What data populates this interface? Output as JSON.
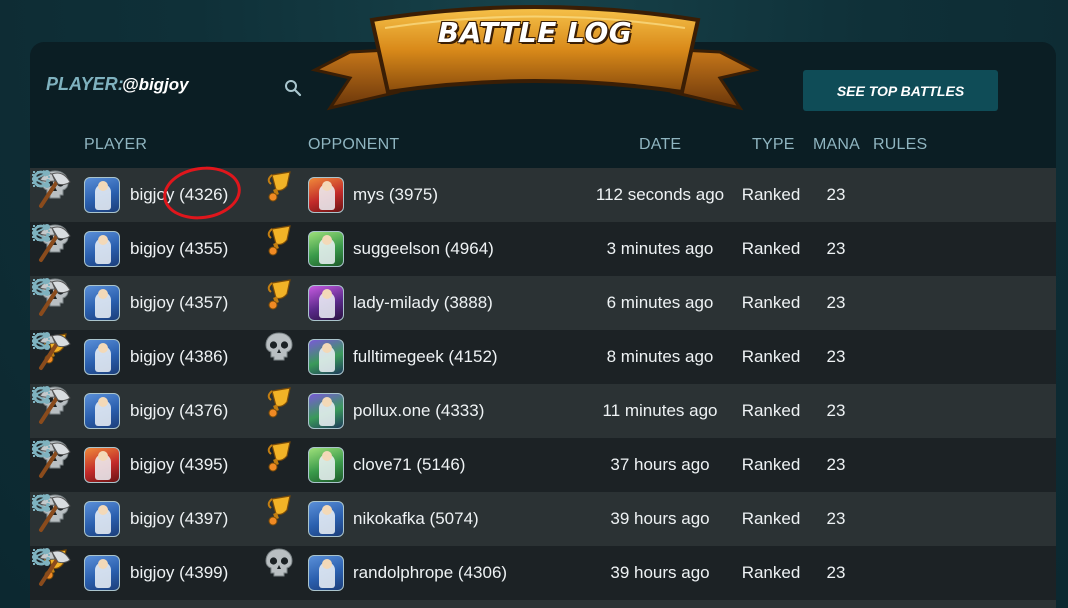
{
  "banner": {
    "title": "BATTLE LOG"
  },
  "player": {
    "label": "PLAYER:",
    "name": "@bigjoy"
  },
  "actions": {
    "top_battles": "SEE TOP BATTLES"
  },
  "columns": {
    "player": "PLAYER",
    "opponent": "OPPONENT",
    "date": "DATE",
    "type": "TYPE",
    "mana": "MANA",
    "rules": "RULES"
  },
  "rows": [
    {
      "result": "loss",
      "player": "bigjoy (4326)",
      "player_avatar": "wizard",
      "opponent": "mys (3975)",
      "opponent_avatar": "dragon",
      "opponent_result": "win",
      "date": "112 seconds ago",
      "type": "Ranked",
      "mana": "23",
      "rule_icon": "axe-icon"
    },
    {
      "result": "loss",
      "player": "bigjoy (4355)",
      "player_avatar": "wizard",
      "opponent": "suggeelson (4964)",
      "opponent_avatar": "elf",
      "opponent_result": "win",
      "date": "3 minutes ago",
      "type": "Ranked",
      "mana": "23",
      "rule_icon": "axe-icon"
    },
    {
      "result": "loss",
      "player": "bigjoy (4357)",
      "player_avatar": "wizard",
      "opponent": "lady-milady (3888)",
      "opponent_avatar": "jester",
      "opponent_result": "win",
      "date": "6 minutes ago",
      "type": "Ranked",
      "mana": "23",
      "rule_icon": "axe-icon"
    },
    {
      "result": "win",
      "player": "bigjoy (4386)",
      "player_avatar": "wizard",
      "opponent": "fulltimegeek (4152)",
      "opponent_avatar": "monster",
      "opponent_result": "loss",
      "date": "8 minutes ago",
      "type": "Ranked",
      "mana": "23",
      "rule_icon": "axe-icon"
    },
    {
      "result": "loss",
      "player": "bigjoy (4376)",
      "player_avatar": "wizard",
      "opponent": "pollux.one (4333)",
      "opponent_avatar": "monster",
      "opponent_result": "win",
      "date": "11 minutes ago",
      "type": "Ranked",
      "mana": "23",
      "rule_icon": "axe-icon"
    },
    {
      "result": "loss",
      "player": "bigjoy (4395)",
      "player_avatar": "dragon",
      "opponent": "clove71 (5146)",
      "opponent_avatar": "elf",
      "opponent_result": "win",
      "date": "37 hours ago",
      "type": "Ranked",
      "mana": "23",
      "rule_icon": "axe-icon"
    },
    {
      "result": "loss",
      "player": "bigjoy (4397)",
      "player_avatar": "wizard",
      "opponent": "nikokafka (5074)",
      "opponent_avatar": "wizard",
      "opponent_result": "win",
      "date": "39 hours ago",
      "type": "Ranked",
      "mana": "23",
      "rule_icon": "axe-icon"
    },
    {
      "result": "win",
      "player": "bigjoy (4399)",
      "player_avatar": "wizard",
      "opponent": "randolphrope (4306)",
      "opponent_avatar": "wizard",
      "opponent_result": "loss",
      "date": "39 hours ago",
      "type": "Ranked",
      "mana": "23",
      "rule_icon": "axe-icon"
    }
  ],
  "colors": {
    "accent": "#0f4c57",
    "header_text": "#8fb5c0",
    "annotation": "#e0161c"
  }
}
